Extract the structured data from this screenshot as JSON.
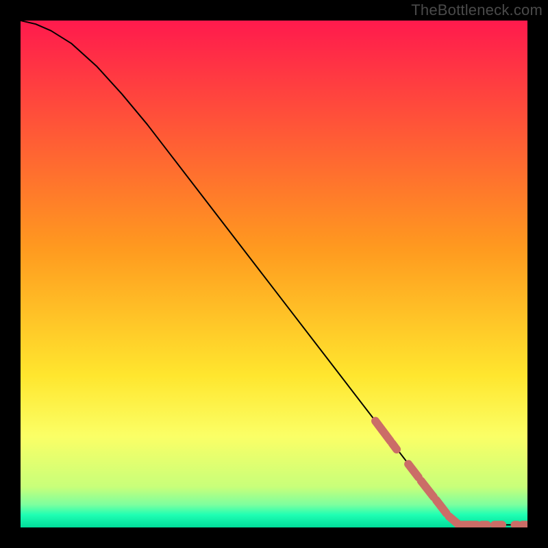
{
  "watermark": "TheBottleneck.com",
  "chart_data": {
    "type": "line",
    "title": "",
    "xlabel": "",
    "ylabel": "",
    "xlim": [
      0,
      100
    ],
    "ylim": [
      0,
      100
    ],
    "gradient_stops": [
      {
        "offset": 0,
        "color": "#ff1a4d"
      },
      {
        "offset": 0.45,
        "color": "#ff9a1f"
      },
      {
        "offset": 0.7,
        "color": "#ffe62e"
      },
      {
        "offset": 0.82,
        "color": "#fbff66"
      },
      {
        "offset": 0.92,
        "color": "#c8ff7a"
      },
      {
        "offset": 0.955,
        "color": "#7dff9e"
      },
      {
        "offset": 0.975,
        "color": "#1fffb3"
      },
      {
        "offset": 1.0,
        "color": "#00dc9a"
      }
    ],
    "curve_points": [
      {
        "x": 0,
        "y": 100
      },
      {
        "x": 3,
        "y": 99.3
      },
      {
        "x": 6,
        "y": 98.0
      },
      {
        "x": 10,
        "y": 95.5
      },
      {
        "x": 15,
        "y": 91.0
      },
      {
        "x": 20,
        "y": 85.5
      },
      {
        "x": 25,
        "y": 79.5
      },
      {
        "x": 30,
        "y": 73.0
      },
      {
        "x": 40,
        "y": 60.0
      },
      {
        "x": 50,
        "y": 47.0
      },
      {
        "x": 60,
        "y": 34.0
      },
      {
        "x": 70,
        "y": 21.0
      },
      {
        "x": 80,
        "y": 8.0
      },
      {
        "x": 86,
        "y": 0.5
      },
      {
        "x": 100,
        "y": 0.5
      }
    ],
    "marker_segments": [
      {
        "x0": 70.0,
        "y0": 21.0,
        "x1": 73.0,
        "y1": 17.0
      },
      {
        "x0": 73.3,
        "y0": 16.6,
        "x1": 74.2,
        "y1": 15.4
      },
      {
        "x0": 76.5,
        "y0": 12.5,
        "x1": 78.5,
        "y1": 9.9
      },
      {
        "x0": 79.0,
        "y0": 9.2,
        "x1": 81.5,
        "y1": 6.0
      },
      {
        "x0": 82.0,
        "y0": 5.4,
        "x1": 84.0,
        "y1": 2.8
      },
      {
        "x0": 84.5,
        "y0": 2.2,
        "x1": 86.5,
        "y1": 0.5
      },
      {
        "x0": 87.0,
        "y0": 0.5,
        "x1": 90.0,
        "y1": 0.5
      },
      {
        "x0": 91.0,
        "y0": 0.5,
        "x1": 92.0,
        "y1": 0.5
      },
      {
        "x0": 93.5,
        "y0": 0.5,
        "x1": 95.0,
        "y1": 0.5
      },
      {
        "x0": 97.5,
        "y0": 0.5,
        "x1": 98.0,
        "y1": 0.5
      },
      {
        "x0": 99.0,
        "y0": 0.5,
        "x1": 99.8,
        "y1": 0.5
      }
    ],
    "marker_color": "#cb6d67",
    "marker_width": 12
  }
}
